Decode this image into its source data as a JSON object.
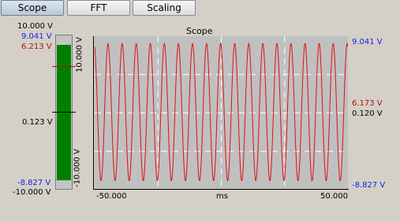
{
  "tabs": [
    {
      "label": "Scope",
      "active": true
    },
    {
      "label": "FFT",
      "active": false
    },
    {
      "label": "Scaling",
      "active": false
    }
  ],
  "meter": {
    "max_label": "10.000 V",
    "peak_high": "9.041 V",
    "rms_high": "6.213 V",
    "mean": "0.123 V",
    "peak_low": "-8.827 V",
    "min_label": "-10.000 V",
    "fill_color": "#008000"
  },
  "scope": {
    "title": "Scope",
    "y_top_label": "10.000 V",
    "y_bottom_label": "-10.000 V",
    "x_left_label": "-50.000",
    "x_unit": "ms",
    "x_right_label": "50.000",
    "right_peak_high": "9.041 V",
    "right_rms": "6.173 V",
    "right_mean": "0.120 V",
    "right_peak_low": "-8.827 V"
  },
  "colors": {
    "blue_marker": "#1a1ae6",
    "red_marker": "#b01010",
    "signal": "#e01010",
    "plot_bg": "#c0c0c0"
  },
  "chart_data": {
    "type": "line",
    "title": "Scope",
    "xlabel": "ms",
    "ylabel": "",
    "xlim": [
      -50,
      50
    ],
    "ylim": [
      -10,
      10
    ],
    "grid": true,
    "series": [
      {
        "signal": "sine",
        "cycles": 18,
        "max": 9.041,
        "min": -8.827,
        "mean": 0.12
      }
    ]
  }
}
